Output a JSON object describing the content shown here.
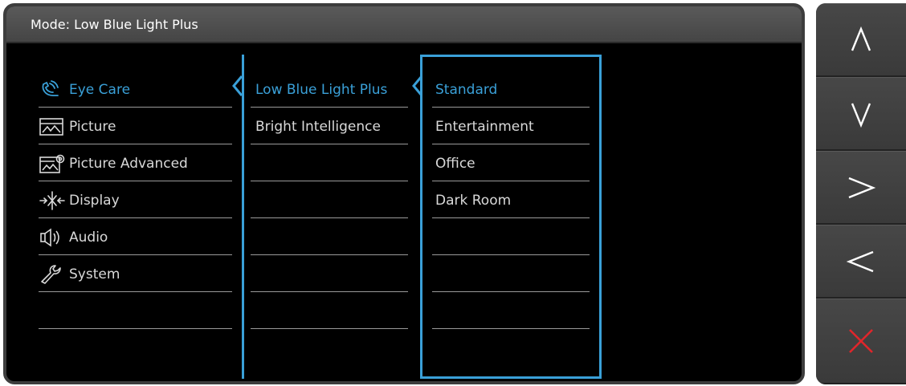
{
  "osd": {
    "title": "Mode: Low Blue Light Plus",
    "accent_color": "#3aa0d8",
    "text_color": "#d9d9d9"
  },
  "menu": {
    "items": [
      {
        "label": "Eye Care",
        "icon": "eye-care-icon",
        "active": true
      },
      {
        "label": "Picture",
        "icon": "picture-icon",
        "active": false
      },
      {
        "label": "Picture Advanced",
        "icon": "picture-advanced-icon",
        "active": false
      },
      {
        "label": "Display",
        "icon": "display-icon",
        "active": false
      },
      {
        "label": "Audio",
        "icon": "audio-icon",
        "active": false
      },
      {
        "label": "System",
        "icon": "system-icon",
        "active": false
      }
    ]
  },
  "submenu": {
    "items": [
      {
        "label": "Low Blue Light Plus",
        "active": true
      },
      {
        "label": "Bright Intelligence",
        "active": false
      }
    ]
  },
  "options": {
    "items": [
      {
        "label": "Standard",
        "active": true
      },
      {
        "label": "Entertainment",
        "active": false
      },
      {
        "label": "Office",
        "active": false
      },
      {
        "label": "Dark Room",
        "active": false
      }
    ]
  },
  "controls": {
    "buttons": [
      {
        "icon": "up-arrow-icon",
        "color": "#ffffff"
      },
      {
        "icon": "down-arrow-icon",
        "color": "#ffffff"
      },
      {
        "icon": "right-arrow-icon",
        "color": "#ffffff"
      },
      {
        "icon": "left-arrow-icon",
        "color": "#ffffff"
      },
      {
        "icon": "close-icon",
        "color": "#e0262b"
      }
    ]
  }
}
